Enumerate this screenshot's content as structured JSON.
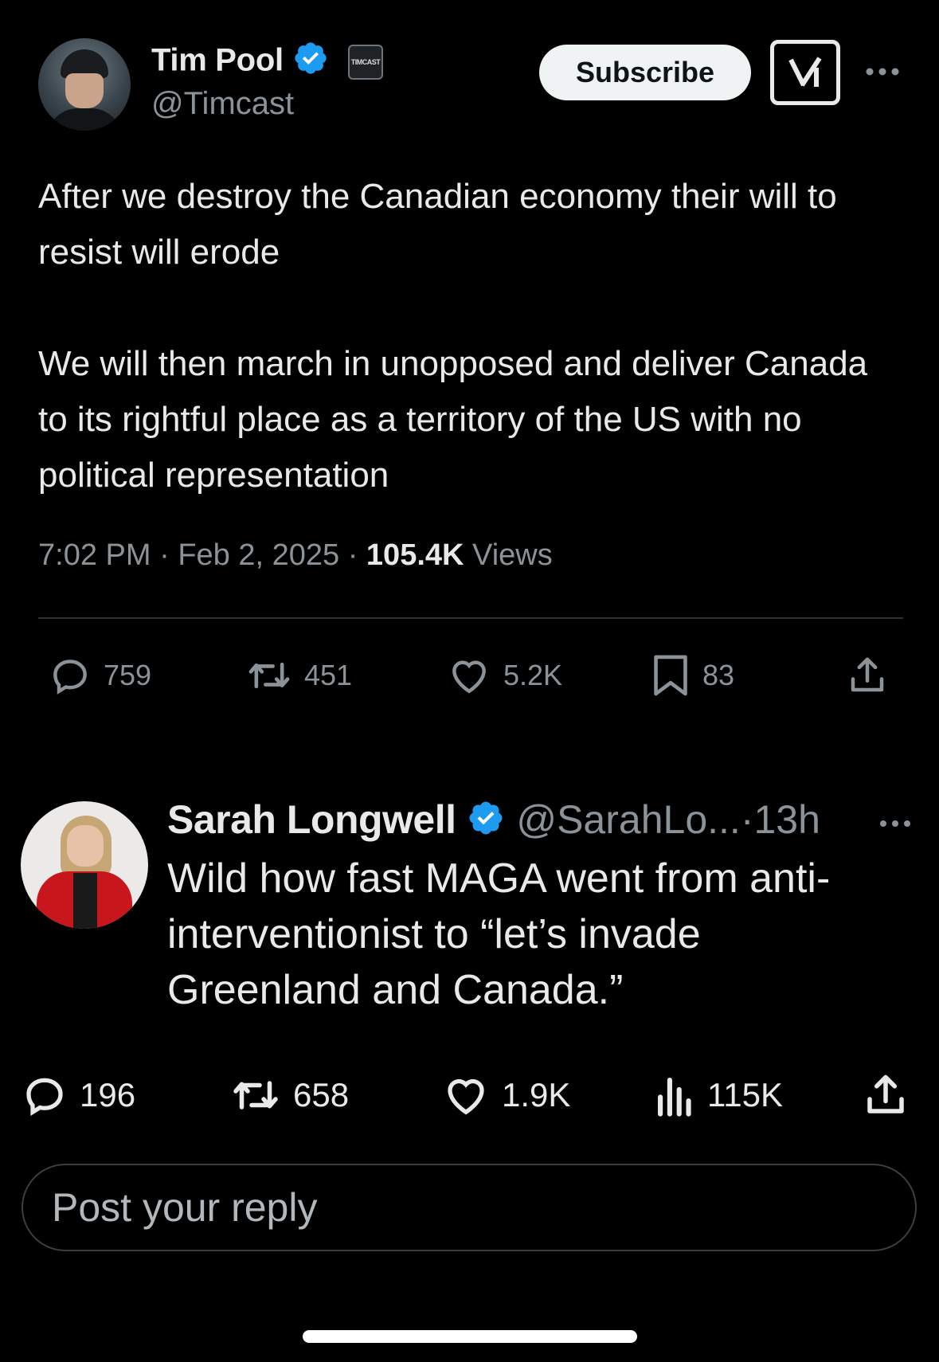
{
  "main_tweet": {
    "author_name": "Tim Pool",
    "author_handle": "@Timcast",
    "affiliate_badge_text": "TIMCAST",
    "subscribe_label": "Subscribe",
    "text_paragraph_1": "After we destroy the Canadian economy their will to resist will erode",
    "text_paragraph_2": "We will then march in unopposed and  deliver Canada to its rightful place as a territory of the US with no political representation",
    "time": "7:02 PM",
    "date": "Feb 2, 2025",
    "views_count": "105.4K",
    "views_label": "Views",
    "separator": "·",
    "stats": {
      "replies": "759",
      "reposts": "451",
      "likes": "5.2K",
      "bookmarks": "83"
    }
  },
  "reply_tweet": {
    "author_name": "Sarah Longwell",
    "author_handle": "@SarahLo...",
    "time_ago": "13h",
    "separator": "·",
    "text": "Wild how fast MAGA went from anti-interventionist to “let’s invade Greenland and Canada.”",
    "stats": {
      "replies": "196",
      "reposts": "658",
      "likes": "1.9K",
      "views": "115K"
    }
  },
  "reply_input": {
    "placeholder": "Post your reply"
  },
  "icons": {
    "verified": "verified-badge-icon",
    "grok": "grok-icon",
    "more": "more-horizontal-icon",
    "reply": "reply-icon",
    "repost": "repost-icon",
    "like": "heart-icon",
    "bookmark": "bookmark-icon",
    "share": "share-icon",
    "views": "views-icon"
  },
  "colors": {
    "background": "#000000",
    "text": "#e7e9ea",
    "secondary_text": "#8b9298",
    "verified_blue": "#1d9bf0"
  }
}
